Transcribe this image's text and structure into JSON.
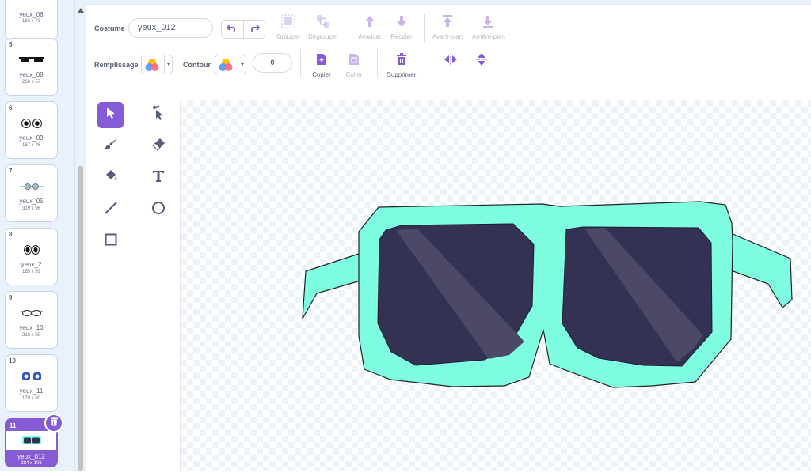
{
  "costumes": [
    {
      "num": "",
      "name": "yeux_06",
      "size": "183 x 73"
    },
    {
      "num": "5",
      "name": "yeux_08",
      "size": "266 x 57"
    },
    {
      "num": "6",
      "name": "yeux_09",
      "size": "167 x 76"
    },
    {
      "num": "7",
      "name": "yeux_05",
      "size": "319 x 96"
    },
    {
      "num": "8",
      "name": "yeux_2",
      "size": "155 x 59"
    },
    {
      "num": "9",
      "name": "yeux_10",
      "size": "316 x 86"
    },
    {
      "num": "10",
      "name": "yeux_11",
      "size": "179 x 80"
    },
    {
      "num": "11",
      "name": "yeux_012",
      "size": "284 x 106",
      "selected": true
    }
  ],
  "toolbar": {
    "costume_label": "Costume",
    "costume_name": "yeux_012",
    "group": "Grouper",
    "ungroup": "Dégrouper",
    "forward": "Avancer",
    "backward": "Reculer",
    "front": "Avant-plan",
    "back": "Arrière-plan",
    "fill_label": "Remplissage",
    "outline_label": "Contour",
    "outline_width": "0",
    "copy": "Copier",
    "paste": "Coller",
    "delete": "Supprimer"
  },
  "colors": {
    "accent": "#855cd6",
    "frame": "#7ffde0",
    "lens": "#343253",
    "lens_shine": "#4c4968"
  },
  "icons": [
    "select-icon",
    "reshape-icon",
    "brush-icon",
    "eraser-icon",
    "fill-icon",
    "text-icon",
    "line-icon",
    "circle-icon",
    "rectangle-icon"
  ]
}
